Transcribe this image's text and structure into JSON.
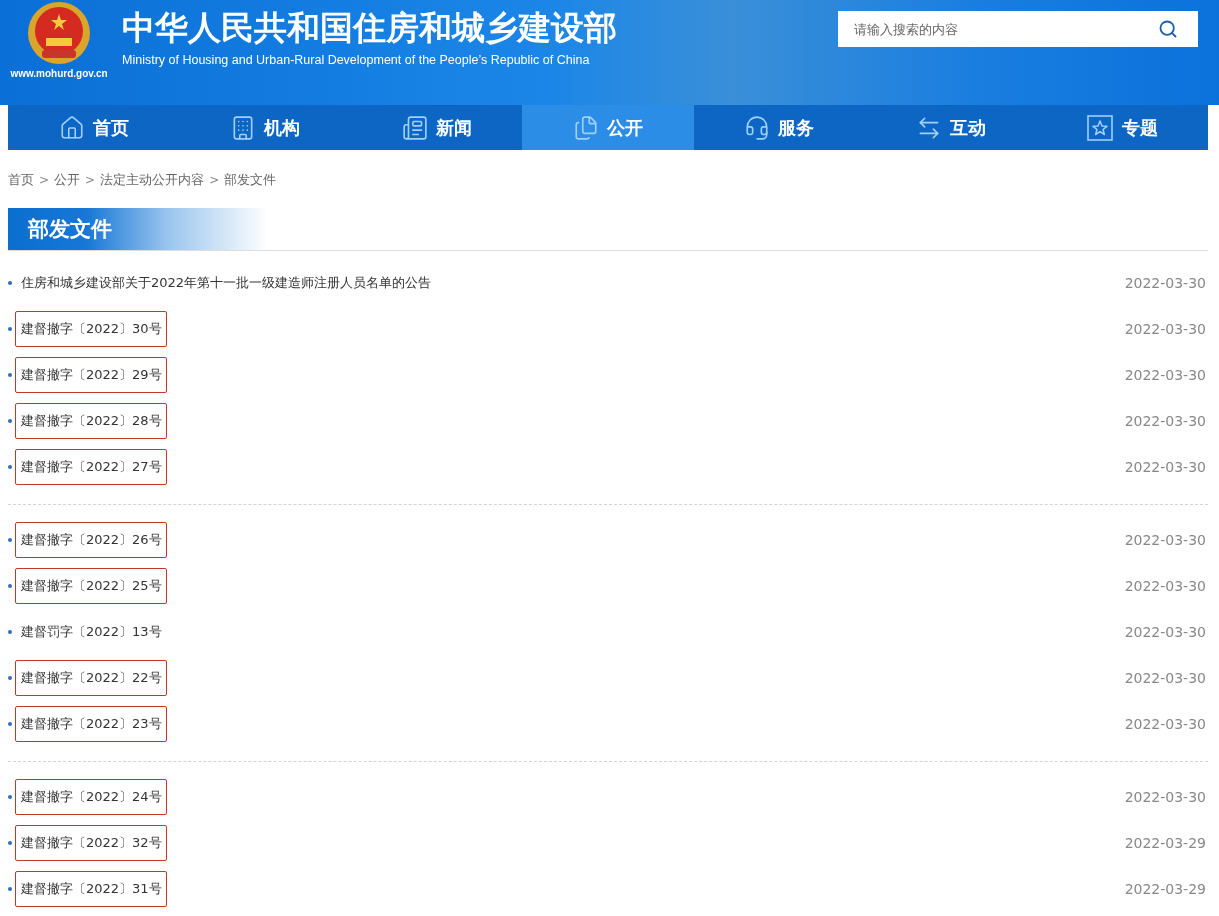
{
  "header": {
    "title": "中华人民共和国住房和城乡建设部",
    "subtitle": "Ministry of Housing and Urban-Rural Development of the People’s Republic of China",
    "url": "www.mohurd.gov.cn",
    "search": {
      "placeholder": "请输入搜索的内容"
    }
  },
  "nav": [
    {
      "label": "首页",
      "kind": "home",
      "selected": false
    },
    {
      "label": "机构",
      "kind": "building",
      "selected": false
    },
    {
      "label": "新闻",
      "kind": "news",
      "selected": false
    },
    {
      "label": "公开",
      "kind": "docs",
      "selected": true
    },
    {
      "label": "服务",
      "kind": "service",
      "selected": false
    },
    {
      "label": "互动",
      "kind": "interact",
      "selected": false
    },
    {
      "label": "专题",
      "kind": "star",
      "selected": false
    }
  ],
  "breadcrumb": [
    "首页",
    "公开",
    "法定主动公开内容",
    "部发文件"
  ],
  "breadcrumb_separator": ">",
  "section_title": "部发文件",
  "groups": [
    {
      "items": [
        {
          "title": "住房和城乡建设部关于2022年第十一批一级建造师注册人员名单的公告",
          "date": "2022-03-30",
          "highlighted": false
        },
        {
          "title": "建督撤字〔2022〕30号",
          "date": "2022-03-30",
          "highlighted": true
        },
        {
          "title": "建督撤字〔2022〕29号",
          "date": "2022-03-30",
          "highlighted": true
        },
        {
          "title": "建督撤字〔2022〕28号",
          "date": "2022-03-30",
          "highlighted": true
        },
        {
          "title": "建督撤字〔2022〕27号",
          "date": "2022-03-30",
          "highlighted": true
        }
      ]
    },
    {
      "items": [
        {
          "title": "建督撤字〔2022〕26号",
          "date": "2022-03-30",
          "highlighted": true
        },
        {
          "title": "建督撤字〔2022〕25号",
          "date": "2022-03-30",
          "highlighted": true
        },
        {
          "title": "建督罚字〔2022〕13号",
          "date": "2022-03-30",
          "highlighted": false
        },
        {
          "title": "建督撤字〔2022〕22号",
          "date": "2022-03-30",
          "highlighted": true
        },
        {
          "title": "建督撤字〔2022〕23号",
          "date": "2022-03-30",
          "highlighted": true
        }
      ]
    },
    {
      "items": [
        {
          "title": "建督撤字〔2022〕24号",
          "date": "2022-03-30",
          "highlighted": true
        },
        {
          "title": "建督撤字〔2022〕32号",
          "date": "2022-03-29",
          "highlighted": true
        },
        {
          "title": "建督撤字〔2022〕31号",
          "date": "2022-03-29",
          "highlighted": true
        }
      ]
    }
  ]
}
